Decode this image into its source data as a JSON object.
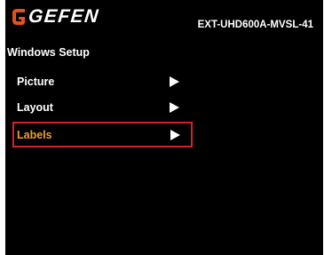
{
  "header": {
    "logo_text": "GEFEN",
    "model": "EXT-UHD600A-MVSL-41"
  },
  "menu": {
    "title": "Windows Setup",
    "items": [
      {
        "label": "Picture",
        "arrow_icon": "right-triangle-icon",
        "selected": false
      },
      {
        "label": "Layout",
        "arrow_icon": "right-triangle-icon",
        "selected": false
      },
      {
        "label": "Labels",
        "arrow_icon": "right-triangle-icon",
        "selected": true
      }
    ]
  },
  "colors": {
    "background": "#000000",
    "text": "#ffffff",
    "selected_text": "#f0a020",
    "selection_border": "#d8202a",
    "logo_accent": "#e8501a"
  }
}
